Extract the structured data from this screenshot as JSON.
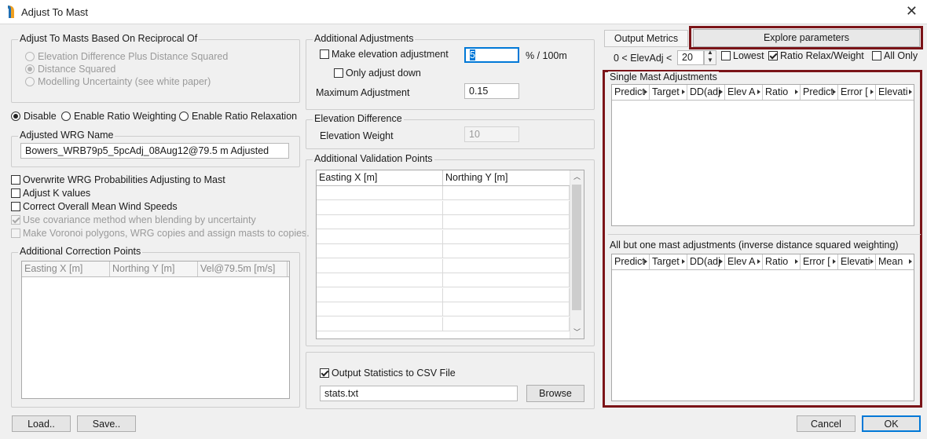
{
  "window": {
    "title": "Adjust To Mast"
  },
  "reciprocal": {
    "legend": "Adjust To Masts Based On Reciprocal Of",
    "options": [
      "Elevation Difference Plus Distance Squared",
      "Distance Squared",
      "Modelling Uncertainty (see white paper)"
    ],
    "selected": "Distance Squared"
  },
  "weighting": {
    "options": [
      "Disable",
      "Enable Ratio Weighting",
      "Enable Ratio Relaxation"
    ],
    "selected": "Disable"
  },
  "adjusted_wrg": {
    "legend": "Adjusted WRG Name",
    "value": "Bowers_WRB79p5_5pcAdj_08Aug12@79.5 m Adjusted"
  },
  "options": [
    {
      "label": "Overwrite WRG Probabilities Adjusting to Mast",
      "checked": false,
      "enabled": true
    },
    {
      "label": "Adjust K values",
      "checked": false,
      "enabled": true
    },
    {
      "label": "Correct Overall Mean Wind Speeds",
      "checked": false,
      "enabled": true
    },
    {
      "label": "Use covariance method when blending by uncertainty",
      "checked": true,
      "enabled": false
    },
    {
      "label": "Make Voronoi polygons, WRG copies and assign masts to copies.",
      "checked": false,
      "enabled": false
    }
  ],
  "correction_points": {
    "legend": "Additional Correction Points",
    "columns": [
      "Easting X [m]",
      "Northing Y [m]",
      "Vel@79.5m [m/s]"
    ]
  },
  "additional_adjustments": {
    "legend": "Additional Adjustments",
    "make_elevation_label": "Make elevation adjustment",
    "make_elevation_checked": false,
    "elevation_value": "5",
    "elevation_unit": "% / 100m",
    "only_down_label": "Only adjust down",
    "only_down_checked": false,
    "max_adjustment_label": "Maximum Adjustment",
    "max_adjustment_value": "0.15"
  },
  "elevation_difference": {
    "legend": "Elevation Difference",
    "weight_label": "Elevation Weight",
    "weight_value": "10"
  },
  "validation_points": {
    "legend": "Additional Validation Points",
    "columns": [
      "Easting X [m]",
      "Northing Y [m]"
    ]
  },
  "output_stats": {
    "label": "Output Statistics to CSV File",
    "checked": true,
    "filename": "stats.txt",
    "browse_label": "Browse"
  },
  "right_panel": {
    "output_metrics_tab": "Output Metrics",
    "explore_button": "Explore parameters",
    "elevadj_label": "0 < ElevAdj <",
    "elevadj_value": "20",
    "lowest_label": "Lowest",
    "lowest_checked": false,
    "ratio_relax_label": "Ratio Relax/Weight",
    "ratio_relax_checked": true,
    "all_only_label": "All Only",
    "all_only_checked": false,
    "single_mast": {
      "legend": "Single Mast Adjustments",
      "columns": [
        "Predict",
        "Target",
        "DD(adj",
        "Elev A",
        "Ratio",
        "Predict",
        "Error [",
        "Elevati"
      ]
    },
    "all_but_one": {
      "legend": "All but one mast adjustments (inverse distance squared weighting)",
      "columns": [
        "Predict",
        "Target",
        "DD(adj",
        "Elev A",
        "Ratio",
        "Error [",
        "Elevati",
        "Mean"
      ]
    }
  },
  "bottom_buttons": {
    "load": "Load..",
    "save": "Save..",
    "cancel": "Cancel",
    "ok": "OK"
  },
  "colors": {
    "highlight_border": "#7b1418",
    "focus_border": "#0078d7"
  }
}
